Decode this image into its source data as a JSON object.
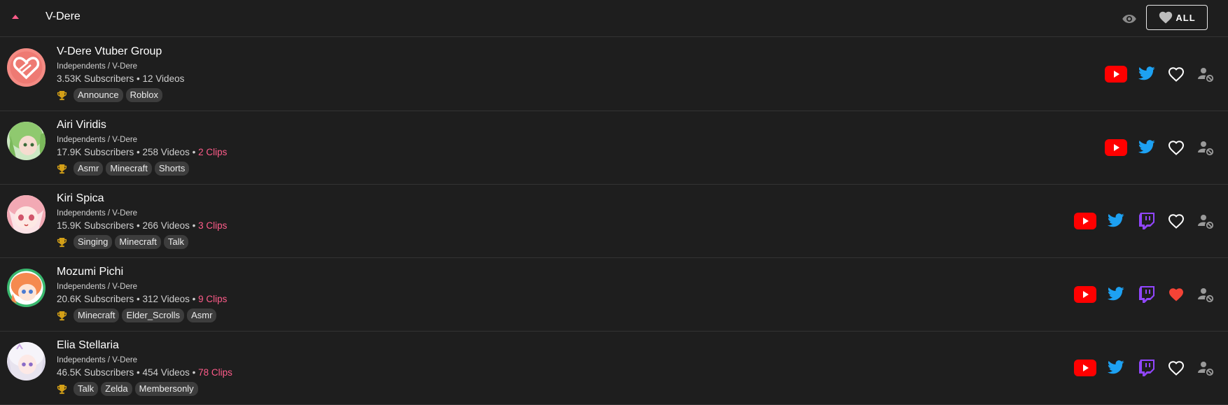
{
  "group": {
    "title": "V-Dere",
    "all_label": "ALL"
  },
  "colors": {
    "accent_pink": "#ff5c8a",
    "youtube_red": "#ff0000",
    "twitter_blue": "#1da1f2",
    "twitch_purple": "#9146ff",
    "fav_red": "#f44336"
  },
  "channels": [
    {
      "name": "V-Dere Vtuber Group",
      "org": "Independents / V-Dere",
      "stats": "3.53K Subscribers • 12 Videos",
      "clips": "",
      "tags": [
        "Announce",
        "Roblox"
      ],
      "has_twitch": false,
      "favorited": false,
      "avatar": "heart-logo"
    },
    {
      "name": "Airi Viridis",
      "org": "Independents / V-Dere",
      "stats": "17.9K Subscribers • 258 Videos • ",
      "clips": "2 Clips",
      "tags": [
        "Asmr",
        "Minecraft",
        "Shorts"
      ],
      "has_twitch": false,
      "favorited": false,
      "avatar": "green-hair"
    },
    {
      "name": "Kiri Spica",
      "org": "Independents / V-Dere",
      "stats": "15.9K Subscribers • 266 Videos • ",
      "clips": "3 Clips",
      "tags": [
        "Singing",
        "Minecraft",
        "Talk"
      ],
      "has_twitch": true,
      "favorited": false,
      "avatar": "pink-hair"
    },
    {
      "name": "Mozumi Pichi",
      "org": "Independents / V-Dere",
      "stats": "20.6K Subscribers • 312 Videos • ",
      "clips": "9 Clips",
      "tags": [
        "Minecraft",
        "Elder_Scrolls",
        "Asmr"
      ],
      "has_twitch": true,
      "favorited": true,
      "avatar": "orange-hair"
    },
    {
      "name": "Elia Stellaria",
      "org": "Independents / V-Dere",
      "stats": "46.5K Subscribers • 454 Videos • ",
      "clips": "78 Clips",
      "tags": [
        "Talk",
        "Zelda",
        "Membersonly"
      ],
      "has_twitch": true,
      "favorited": false,
      "avatar": "white-hair"
    }
  ]
}
